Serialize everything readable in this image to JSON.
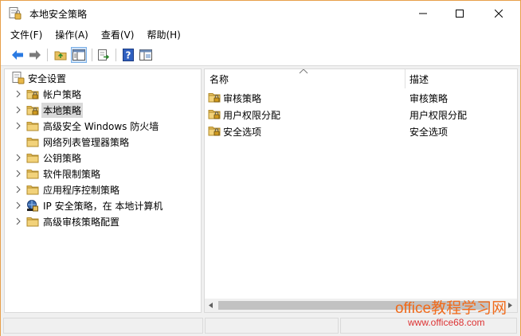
{
  "window": {
    "title": "本地安全策略"
  },
  "menu": [
    {
      "label": "文件(F)"
    },
    {
      "label": "操作(A)"
    },
    {
      "label": "查看(V)"
    },
    {
      "label": "帮助(H)"
    }
  ],
  "toolbar": {
    "buttons": [
      "back-icon",
      "forward-icon",
      "up-folder-icon",
      "show-tree-icon",
      "export-icon",
      "help-icon",
      "properties-icon"
    ]
  },
  "tree": {
    "root": "安全设置",
    "items": [
      {
        "label": "帐户策略",
        "icon": "folder-lock-icon",
        "selected": false
      },
      {
        "label": "本地策略",
        "icon": "folder-lock-icon",
        "selected": true
      },
      {
        "label": "高级安全 Windows 防火墙",
        "icon": "folder-icon",
        "selected": false
      },
      {
        "label": "网络列表管理器策略",
        "icon": "folder-icon",
        "selected": false
      },
      {
        "label": "公钥策略",
        "icon": "folder-icon",
        "selected": false
      },
      {
        "label": "软件限制策略",
        "icon": "folder-icon",
        "selected": false
      },
      {
        "label": "应用程序控制策略",
        "icon": "folder-icon",
        "selected": false
      },
      {
        "label": "IP 安全策略，在 本地计算机",
        "icon": "ip-security-icon",
        "selected": false
      },
      {
        "label": "高级审核策略配置",
        "icon": "folder-icon",
        "selected": false
      }
    ]
  },
  "list": {
    "columns": [
      "名称",
      "描述"
    ],
    "rows": [
      {
        "name": "审核策略",
        "desc": "审核策略"
      },
      {
        "name": "用户权限分配",
        "desc": "用户权限分配"
      },
      {
        "name": "安全选项",
        "desc": "安全选项"
      }
    ]
  },
  "watermark": {
    "text": "office教程学习网",
    "url": "www.office68.com"
  },
  "colors": {
    "window_border": "#e8a04a",
    "folder": "#e8c060",
    "accent_arrow": "#2a7ae2",
    "watermark": "#f06a1a"
  }
}
